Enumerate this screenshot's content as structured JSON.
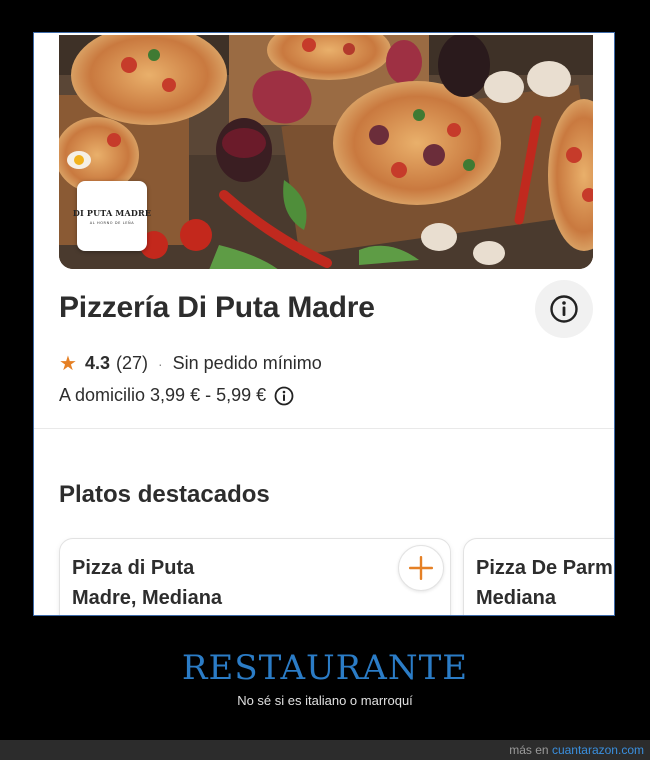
{
  "restaurant": {
    "logo_name": "DI PUTA MADRE",
    "logo_tagline": "AL HORNO DE LEÑA",
    "name": "Pizzería Di Puta Madre",
    "rating": "4.3",
    "reviews": "(27)",
    "separator": "·",
    "min_order": "Sin pedido mínimo",
    "delivery": "A domicilio 3,99 € - 5,99 €"
  },
  "icons": {
    "rating": "star-icon",
    "info": "info-icon",
    "delivery_info": "info-icon",
    "add": "plus-icon"
  },
  "featured": {
    "title": "Platos destacados",
    "dishes": [
      {
        "name": "Pizza di Puta\nMadre, Mediana"
      },
      {
        "name": "Pizza De Parm\nMediana"
      }
    ]
  },
  "meme": {
    "caption": "RESTAURANTE",
    "subcaption": "No sé si es italiano o marroquí"
  },
  "footer": {
    "prefix": "más en",
    "site": "cuantarazon.com"
  },
  "colors": {
    "accent": "#e58025",
    "caption_blue": "#2b7cc6",
    "text": "#2d2d2d"
  }
}
